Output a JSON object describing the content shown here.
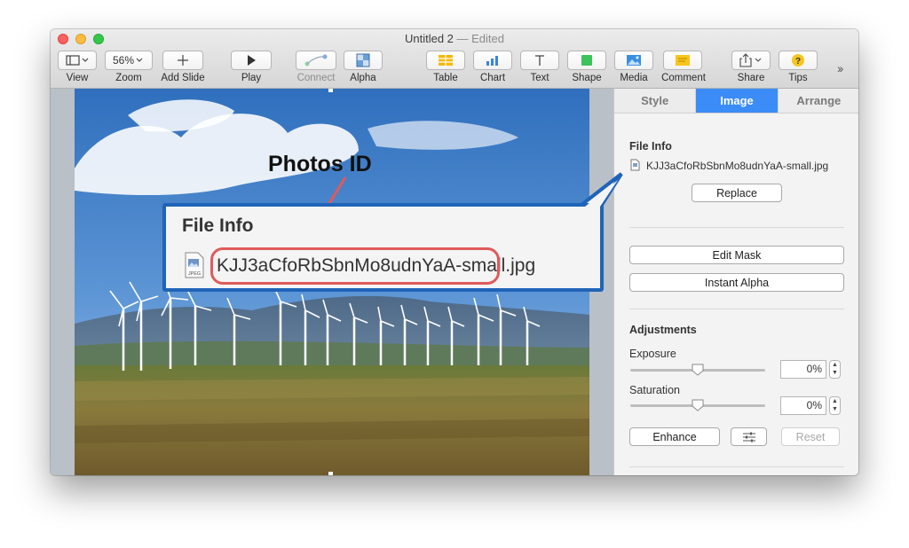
{
  "window": {
    "title": "Untitled 2",
    "separator": "—",
    "status": "Edited"
  },
  "toolbar": {
    "view": "View",
    "zoom": "Zoom",
    "zoom_value": "56%",
    "add_slide": "Add Slide",
    "play": "Play",
    "connect": "Connect",
    "alpha": "Alpha",
    "table": "Table",
    "chart": "Chart",
    "text": "Text",
    "shape": "Shape",
    "media": "Media",
    "comment": "Comment",
    "share": "Share",
    "tips": "Tips"
  },
  "sidebar": {
    "tabs": [
      "Style",
      "Image",
      "Arrange"
    ],
    "active_tab": "Image",
    "file_info_heading": "File Info",
    "file_name": "KJJ3aCfoRbSbnMo8udnYaA-small.jpg",
    "replace": "Replace",
    "edit_mask": "Edit Mask",
    "instant_alpha": "Instant Alpha",
    "adjustments_heading": "Adjustments",
    "exposure_label": "Exposure",
    "exposure_value": "0%",
    "exposure_level": 0.5,
    "saturation_label": "Saturation",
    "saturation_value": "0%",
    "saturation_level": 0.5,
    "enhance": "Enhance",
    "reset": "Reset"
  },
  "callout": {
    "title": "Photos ID",
    "heading": "File Info",
    "file_name": "KJJ3aCfoRbSbnMo8udnYaA-small.jpg",
    "icon_label": "JPEG"
  },
  "colors": {
    "accent": "#3b8cf7",
    "callout_border": "#1f64b8",
    "highlight": "#e05a5a"
  }
}
